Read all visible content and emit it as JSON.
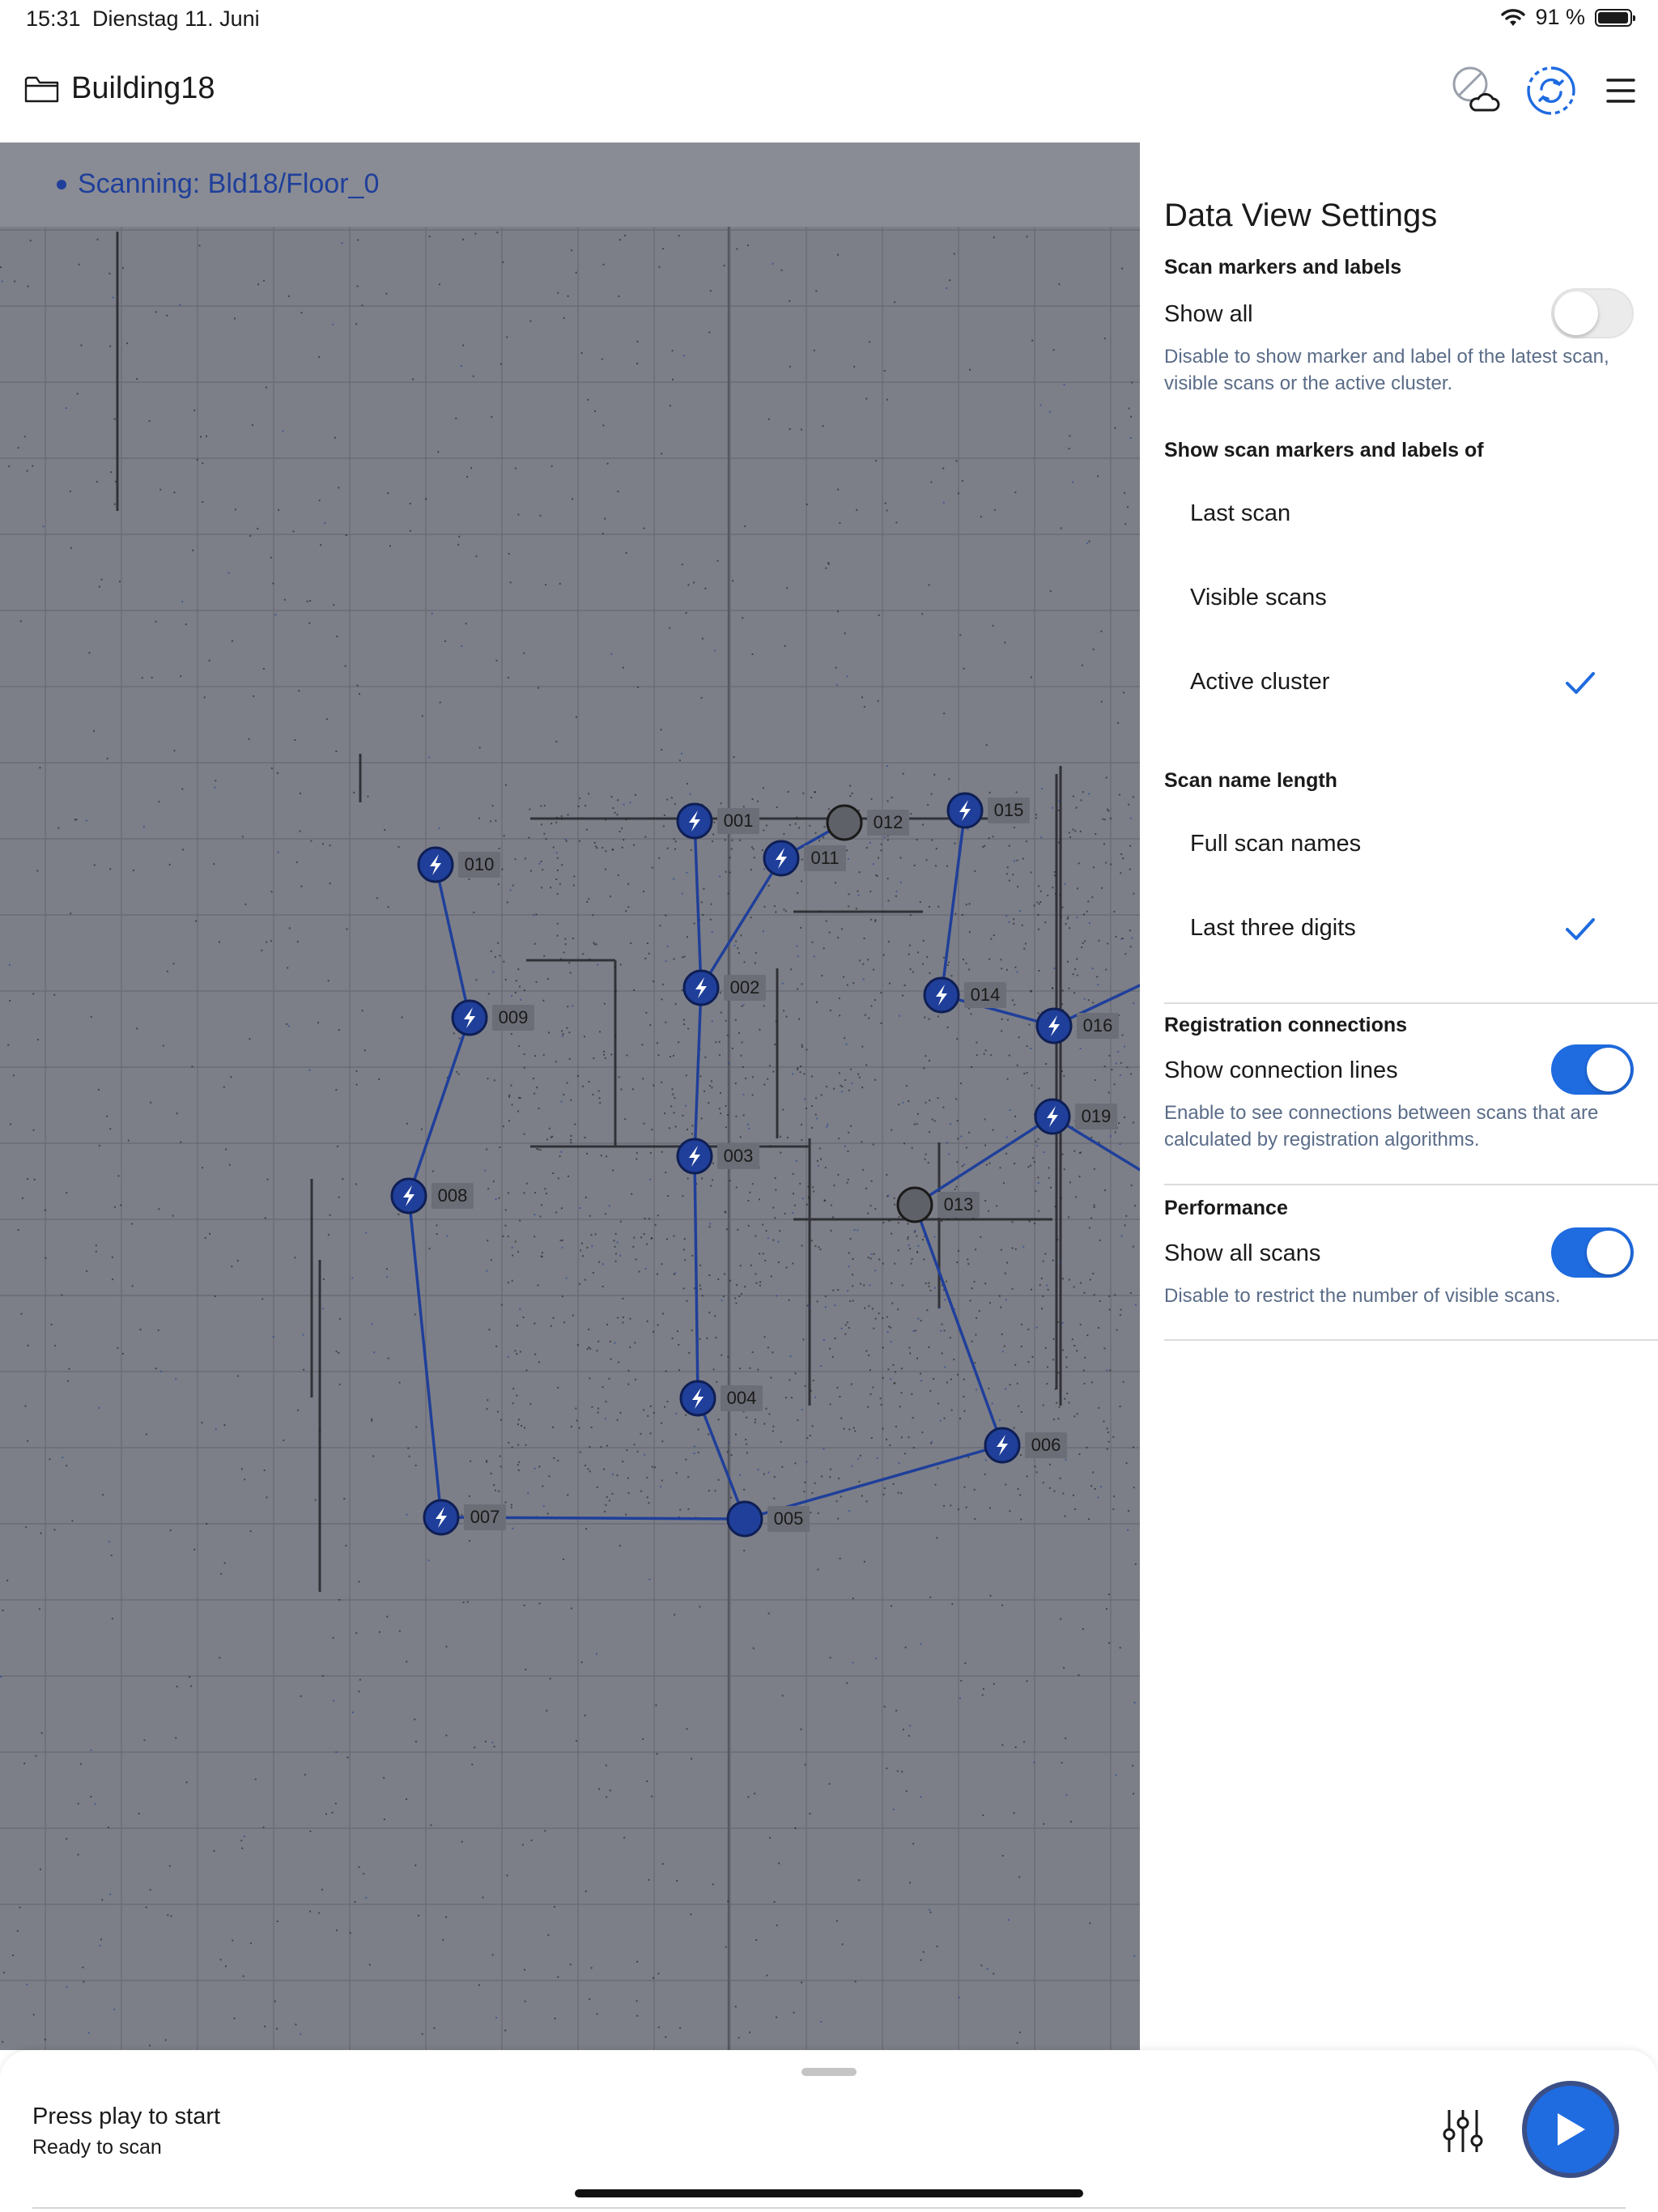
{
  "status_bar": {
    "time": "15:31",
    "date": "Dienstag 11. Juni",
    "battery": "91 %"
  },
  "nav": {
    "title": "Building18",
    "icons": [
      "folder-icon",
      "cloud-off-icon",
      "sync-icon",
      "menu-icon"
    ]
  },
  "map": {
    "scan_status": "Scanning: Bld18/Floor_0",
    "accent": "#1f3f9a",
    "markers": [
      {
        "label": "001",
        "kind": "scan"
      },
      {
        "label": "002",
        "kind": "scan"
      },
      {
        "label": "003",
        "kind": "scan"
      },
      {
        "label": "004",
        "kind": "scan"
      },
      {
        "label": "005",
        "kind": "active"
      },
      {
        "label": "006",
        "kind": "scan"
      },
      {
        "label": "007",
        "kind": "scan"
      },
      {
        "label": "008",
        "kind": "scan"
      },
      {
        "label": "009",
        "kind": "scan"
      },
      {
        "label": "010",
        "kind": "scan"
      },
      {
        "label": "011",
        "kind": "scan"
      },
      {
        "label": "012",
        "kind": "grey"
      },
      {
        "label": "013",
        "kind": "grey"
      },
      {
        "label": "014",
        "kind": "scan"
      },
      {
        "label": "015",
        "kind": "scan"
      },
      {
        "label": "016",
        "kind": "scan"
      },
      {
        "label": "019",
        "kind": "scan"
      }
    ],
    "connections": [
      [
        "010",
        "009"
      ],
      [
        "009",
        "008"
      ],
      [
        "008",
        "007"
      ],
      [
        "007",
        "005"
      ],
      [
        "005",
        "004"
      ],
      [
        "004",
        "003"
      ],
      [
        "003",
        "002"
      ],
      [
        "002",
        "001"
      ],
      [
        "002",
        "011"
      ],
      [
        "011",
        "012"
      ],
      [
        "005",
        "006"
      ],
      [
        "006",
        "013"
      ],
      [
        "013",
        "019"
      ],
      [
        "014",
        "015"
      ],
      [
        "014",
        "016"
      ],
      [
        "016",
        "016-edge"
      ],
      [
        "019",
        "019-edge"
      ]
    ]
  },
  "settings": {
    "title": "Data View Settings",
    "scan_markers": {
      "heading": "Scan markers and labels",
      "show_all_label": "Show all",
      "show_all_on": false,
      "help": "Disable to show marker and label of the latest scan, visible scans or the active cluster."
    },
    "show_of": {
      "heading": "Show scan markers and labels of",
      "options": [
        "Last scan",
        "Visible scans",
        "Active cluster"
      ],
      "selected": "Active cluster"
    },
    "name_length": {
      "heading": "Scan name length",
      "options": [
        "Full scan names",
        "Last three digits"
      ],
      "selected": "Last three digits"
    },
    "registration": {
      "heading": "Registration connections",
      "label": "Show connection lines",
      "on": true,
      "help": "Enable to see connections between scans that are calculated by registration algorithms."
    },
    "performance": {
      "heading": "Performance",
      "label": "Show all scans",
      "on": true,
      "help": "Disable to restrict the number of visible scans."
    },
    "accent": "#1f6be0"
  },
  "bottom": {
    "title": "Press play to start",
    "subtitle": "Ready to scan",
    "icons": [
      "adjust-sliders-icon",
      "play-icon"
    ]
  }
}
